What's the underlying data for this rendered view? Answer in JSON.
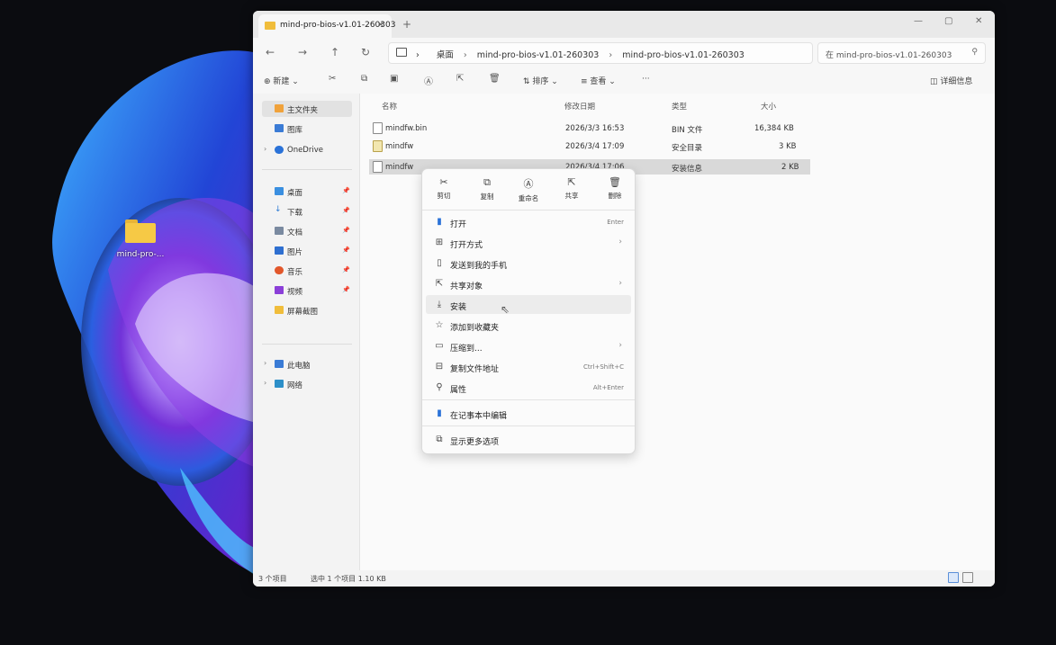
{
  "desktop": {
    "icon_label": "mind-pro-..."
  },
  "window": {
    "tab_title": "mind-pro-bios-v1.01-260303",
    "tab_close": "×",
    "new_tab": "+",
    "minimize": "—",
    "maximize": "▢",
    "close": "✕"
  },
  "nav": {
    "back": "←",
    "forward": "→",
    "up": "↑",
    "refresh": "↻",
    "crumb_root": "›",
    "breadcrumbs": [
      "桌面",
      "mind-pro-bios-v1.01-260303",
      "mind-pro-bios-v1.01-260303"
    ],
    "search_placeholder": "在 mind-pro-bios-v1.01-260303",
    "search_icon": "⚲"
  },
  "toolbar": {
    "new_label": "新建",
    "sort_label": "排序",
    "view_label": "查看",
    "more": "···",
    "details_label": "详细信息"
  },
  "sidebar": {
    "home": "主文件夹",
    "gallery": "图库",
    "onedrive": "OneDrive",
    "desktop": "桌面",
    "downloads": "下载",
    "documents": "文档",
    "pictures": "图片",
    "music": "音乐",
    "videos": "视频",
    "screenshots": "屏幕截图",
    "this_pc": "此电脑",
    "network": "网络"
  },
  "columns": {
    "name": "名称",
    "date": "修改日期",
    "type": "类型",
    "size": "大小"
  },
  "files": [
    {
      "name": "mindfw.bin",
      "date": "2026/3/3 16:53",
      "type": "BIN 文件",
      "size": "16,384 KB"
    },
    {
      "name": "mindfw",
      "date": "2026/3/4 17:09",
      "type": "安全目录",
      "size": "3 KB"
    },
    {
      "name": "mindfw",
      "date": "2026/3/4 17:06",
      "type": "安装信息",
      "size": "2 KB"
    }
  ],
  "status": {
    "count": "3 个项目",
    "selected": "选中 1 个项目  1.10 KB"
  },
  "context_menu": {
    "quick": {
      "cut": "剪切",
      "copy": "复制",
      "rename": "重命名",
      "share": "共享",
      "delete": "删除"
    },
    "items": {
      "open": "打开",
      "open_shortcut": "Enter",
      "open_with": "打开方式",
      "send_phone": "发送到我的手机",
      "share_to": "共享对象",
      "install": "安装",
      "add_fav": "添加到收藏夹",
      "compress": "压缩到...",
      "copy_path": "复制文件地址",
      "copy_path_shortcut": "Ctrl+Shift+C",
      "properties": "属性",
      "properties_shortcut": "Alt+Enter",
      "edit_notepad": "在记事本中编辑",
      "more_options": "显示更多选项"
    }
  },
  "colors": {
    "accent": "#3a7bd5",
    "folder": "#f6c945",
    "selection": "#d9d9d9"
  }
}
